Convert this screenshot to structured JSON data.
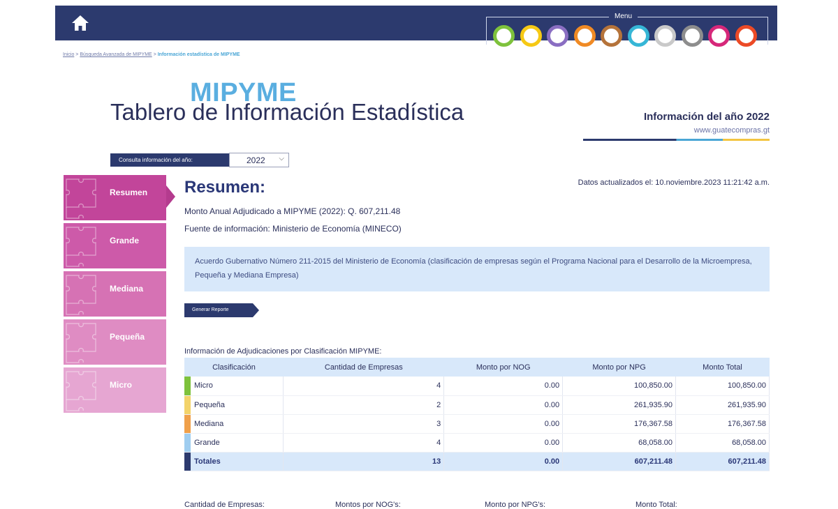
{
  "header": {
    "menu_label": "Menu",
    "menu_circles": [
      "#7ec23c",
      "#f6c915",
      "#8a6ec2",
      "#f08a24",
      "#b5733a",
      "#36b6d6",
      "#c9c9c9",
      "#8d8d8d",
      "#d6287a",
      "#ec4a26"
    ]
  },
  "breadcrumb": {
    "home": "Inicio",
    "sep": ">",
    "advanced": "Búsqueda Avanzada de MIPYME",
    "current": "Información estadística de MIPYME"
  },
  "brand": {
    "mipyme": "MIPYME",
    "title": "Tablero de Información Estadística",
    "info_year": "Información del año 2022",
    "url": "www.guatecompras.gt"
  },
  "year_selector": {
    "label": "Consulta información del año:",
    "value": "2022"
  },
  "updated": "Datos actualizados el: 10.noviembre.2023 11:21:42 a.m.",
  "tabs": [
    {
      "label": "Resumen",
      "color": "#c2459a"
    },
    {
      "label": "Grande",
      "color": "#cd5aa9"
    },
    {
      "label": "Mediana",
      "color": "#d672b4"
    },
    {
      "label": "Pequeña",
      "color": "#df8cc3"
    },
    {
      "label": "Micro",
      "color": "#e6a6d2"
    }
  ],
  "summary": {
    "heading": "Resumen:",
    "monto_anual": "Monto Anual Adjudicado a MIPYME (2022): Q. 607,211.48",
    "fuente": "Fuente de información: Ministerio de Economía (MINECO)",
    "notice": "Acuerdo Gubernativo Número 211-2015 del Ministerio de Economía (clasificación de empresas según el Programa Nacional para el Desarrollo de la Microempresa, Pequeña y Mediana Empresa)",
    "report_button": "Generar Reporte"
  },
  "table": {
    "caption": "Información de Adjudicaciones por Clasificación MIPYME:",
    "headers": [
      "Clasificación",
      "Cantidad de Empresas",
      "Monto por NOG",
      "Monto por NPG",
      "Monto Total"
    ],
    "rows": [
      {
        "name": "Micro",
        "color": "#7ec23c",
        "empresas": "4",
        "nog": "0.00",
        "npg": "100,850.00",
        "total": "100,850.00"
      },
      {
        "name": "Pequeña",
        "color": "#f3d36a",
        "empresas": "2",
        "nog": "0.00",
        "npg": "261,935.90",
        "total": "261,935.90"
      },
      {
        "name": "Mediana",
        "color": "#f0a04a",
        "empresas": "3",
        "nog": "0.00",
        "npg": "176,367.58",
        "total": "176,367.58"
      },
      {
        "name": "Grande",
        "color": "#9fcdf0",
        "empresas": "4",
        "nog": "0.00",
        "npg": "68,058.00",
        "total": "68,058.00"
      },
      {
        "name": "Totales",
        "color": "#2c3a6e",
        "empresas": "13",
        "nog": "0.00",
        "npg": "607,211.48",
        "total": "607,211.48"
      }
    ]
  },
  "bottom_labels": [
    "Cantidad de Empresas:",
    "Montos por NOG's:",
    "Monto por NPG's:",
    "Monto Total:"
  ]
}
